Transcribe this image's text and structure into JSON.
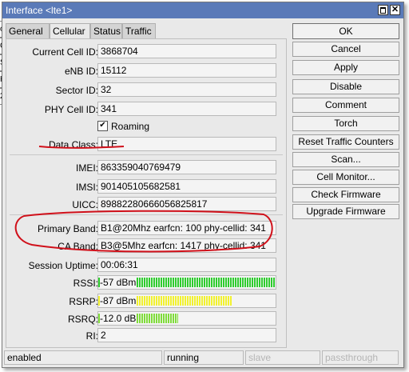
{
  "window": {
    "title": "Interface <lte1>",
    "maximize_glyph": "",
    "close_glyph": "✕"
  },
  "behind_window": [
    "ok",
    "C",
    "S",
    "H",
    "2C"
  ],
  "tabs": [
    {
      "label": "General"
    },
    {
      "label": "Cellular"
    },
    {
      "label": "Status"
    },
    {
      "label": "Traffic"
    }
  ],
  "fields": {
    "current_cell_id": {
      "label": "Current Cell ID:",
      "value": "3868704"
    },
    "enb_id": {
      "label": "eNB ID:",
      "value": "15112"
    },
    "sector_id": {
      "label": "Sector ID:",
      "value": "32"
    },
    "phy_cell_id": {
      "label": "PHY Cell ID:",
      "value": "341"
    },
    "roaming": {
      "label": "Roaming",
      "checked": true
    },
    "data_class": {
      "label": "Data Class:",
      "value": "LTE"
    },
    "imei": {
      "label": "IMEI:",
      "value": "863359040769479"
    },
    "imsi": {
      "label": "IMSI:",
      "value": "901405105682581"
    },
    "uicc": {
      "label": "UICC:",
      "value": "89882280666056825817"
    },
    "primary_band": {
      "label": "Primary Band:",
      "value": "B1@20Mhz earfcn: 100 phy-cellid: 341"
    },
    "ca_band": {
      "label": "CA Band:",
      "value": "B3@5Mhz earfcn: 1417 phy-cellid: 341"
    },
    "session_uptime": {
      "label": "Session Uptime:",
      "value": "00:06:31"
    },
    "rssi": {
      "label": "RSSI:",
      "value": "-57 dBm",
      "level": 1.0,
      "color": "#2ecc2e"
    },
    "rsrp": {
      "label": "RSRP:",
      "value": "-87 dBm",
      "level": 0.75,
      "color": "#f2f22e"
    },
    "rsrq": {
      "label": "RSRQ:",
      "value": "-12.0 dB",
      "level": 0.45,
      "color": "#7fdc3a"
    },
    "ri": {
      "label": "RI:",
      "value": "2"
    }
  },
  "buttons": [
    {
      "label": "OK"
    },
    {
      "label": "Cancel"
    },
    {
      "label": "Apply"
    },
    {
      "label": "Disable"
    },
    {
      "label": "Comment"
    },
    {
      "label": "Torch"
    },
    {
      "label": "Reset Traffic Counters"
    },
    {
      "label": "Scan..."
    },
    {
      "label": "Cell Monitor..."
    },
    {
      "label": "Check Firmware"
    },
    {
      "label": "Upgrade Firmware"
    }
  ],
  "statusbar": {
    "state": "enabled",
    "running": "running",
    "slave": "slave",
    "passthrough": "passthrough"
  },
  "colors": {
    "titlebar": "#5a7ab8",
    "annotation": "#d0101a"
  }
}
